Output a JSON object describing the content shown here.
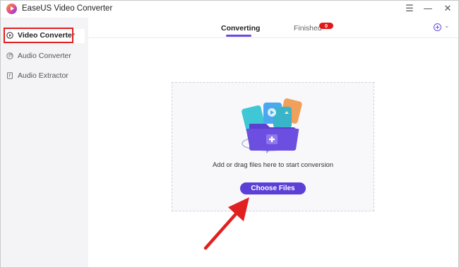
{
  "window": {
    "title": "EaseUS Video Converter",
    "logo_icon": "easeus-play-logo-icon",
    "controls": [
      "menu-icon",
      "minimize-icon",
      "close-icon"
    ]
  },
  "sidebar": {
    "items": [
      {
        "label": "Video Converter",
        "icon": "video-converter-icon",
        "active": true
      },
      {
        "label": "Audio Converter",
        "icon": "audio-converter-icon",
        "active": false
      },
      {
        "label": "Audio Extractor",
        "icon": "audio-extractor-icon",
        "active": false
      }
    ]
  },
  "tabs": {
    "items": [
      {
        "label": "Converting",
        "active": true
      },
      {
        "label": "Finished",
        "active": false,
        "badge": "0"
      }
    ],
    "add_icon": "add-circle-icon",
    "dropdown_icon": "chevron-down-icon"
  },
  "main": {
    "dropzone": {
      "illustration": "folder-with-media-files-icon",
      "text": "Add or drag files here to start conversion",
      "button_label": "Choose Files"
    }
  },
  "colors": {
    "accent": "#5b3fd6",
    "badge": "#e01818",
    "annotation": "#e12020"
  }
}
